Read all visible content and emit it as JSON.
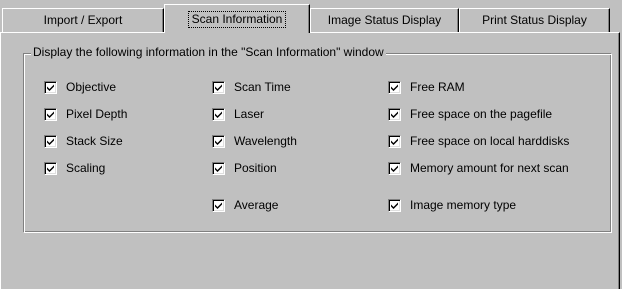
{
  "tabs": [
    {
      "label": "Import / Export"
    },
    {
      "label": "Scan Information"
    },
    {
      "label": "Image Status Display"
    },
    {
      "label": "Print Status Display"
    }
  ],
  "selected_tab": "Scan Information",
  "group": {
    "title": "Display the following information in the \"Scan Information\" window"
  },
  "columns": [
    [
      {
        "label": "Objective",
        "checked": true
      },
      {
        "label": "Pixel Depth",
        "checked": true
      },
      {
        "label": "Stack Size",
        "checked": true
      },
      {
        "label": "Scaling",
        "checked": true
      }
    ],
    [
      {
        "label": "Scan Time",
        "checked": true
      },
      {
        "label": "Laser",
        "checked": true
      },
      {
        "label": "Wavelength",
        "checked": true
      },
      {
        "label": "Position",
        "checked": true
      },
      {
        "label": "Average",
        "checked": true
      }
    ],
    [
      {
        "label": "Free RAM",
        "checked": true
      },
      {
        "label": "Free space on the pagefile",
        "checked": true
      },
      {
        "label": "Free space on local harddisks",
        "checked": true
      },
      {
        "label": "Memory amount for next scan",
        "checked": true
      },
      {
        "label": "Image memory type",
        "checked": true
      }
    ]
  ],
  "icons": {
    "check": "checkmark-icon"
  }
}
